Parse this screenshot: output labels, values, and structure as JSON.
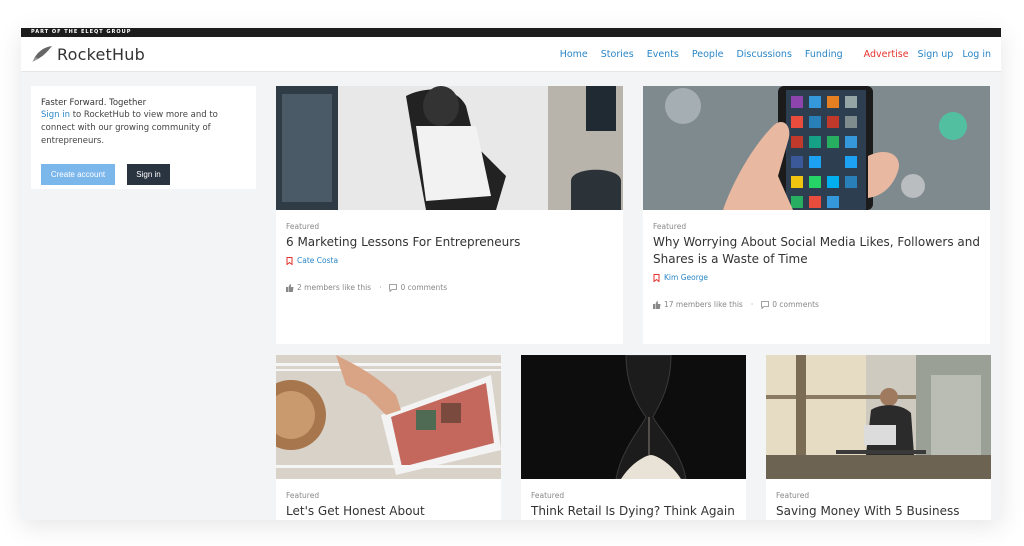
{
  "topstrip": {
    "text": "PART OF THE ELEQT GROUP"
  },
  "header": {
    "logo_text": "RocketHub",
    "nav": [
      {
        "label": "Home"
      },
      {
        "label": "Stories"
      },
      {
        "label": "Events"
      },
      {
        "label": "People"
      },
      {
        "label": "Discussions"
      },
      {
        "label": "Funding"
      }
    ],
    "advertise": "Advertise",
    "signup": "Sign up",
    "login": "Log in"
  },
  "signin_box": {
    "title": "Faster Forward. Together",
    "link": "Sign in",
    "text": " to RocketHub to view more and to connect with our growing community of entrepreneurs.",
    "create_label": "Create account",
    "signin_label": "Sign in"
  },
  "cards": [
    {
      "tag": "Featured",
      "title": "6 Marketing Lessons For Entrepreneurs",
      "author": "Cate Costa",
      "likes": "2 members like this",
      "comments": "0 comments"
    },
    {
      "tag": "Featured",
      "title": "Why Worrying About Social Media Likes, Followers and Shares is a Waste of Time",
      "author": "Kim George",
      "likes": "17 members like this",
      "comments": "0 comments"
    },
    {
      "tag": "Featured",
      "title": "Let's Get Honest About"
    },
    {
      "tag": "Featured",
      "title": "Think Retail Is Dying? Think Again"
    },
    {
      "tag": "Featured",
      "title": "Saving Money With 5 Business"
    }
  ],
  "colors": {
    "link": "#2a86c7",
    "advertise": "#e5322d",
    "primary_btn": "#7cb7ec",
    "dark_btn": "#2a3340"
  }
}
